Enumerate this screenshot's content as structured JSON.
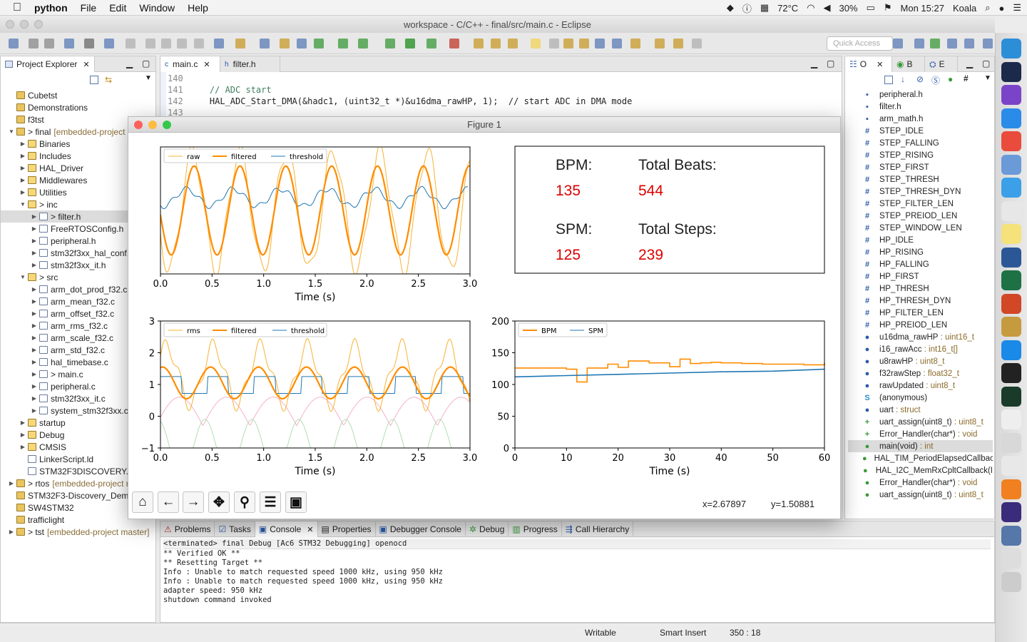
{
  "menubar": {
    "apple": "",
    "app": "python",
    "items": [
      "File",
      "Edit",
      "Window",
      "Help"
    ],
    "status": {
      "temp": "72°C",
      "battery": "30%",
      "clock": "Mon 15:27",
      "user": "Koala"
    }
  },
  "window": {
    "title": "workspace - C/C++ - final/src/main.c - Eclipse",
    "quick_access": "Quick Access"
  },
  "project_explorer": {
    "title": "Project Explorer",
    "rows": [
      {
        "label": "Cubetst",
        "kind": "proj",
        "depth": 0,
        "tw": ""
      },
      {
        "label": "Demonstrations",
        "kind": "proj",
        "depth": 0,
        "tw": ""
      },
      {
        "label": "f3tst",
        "kind": "proj",
        "depth": 0,
        "tw": ""
      },
      {
        "label": "> final",
        "extra": "[embedded-project",
        "kind": "proj",
        "depth": 0,
        "tw": "▼"
      },
      {
        "label": "Binaries",
        "kind": "folder",
        "depth": 1,
        "tw": "▶"
      },
      {
        "label": "Includes",
        "kind": "folder",
        "depth": 1,
        "tw": "▶"
      },
      {
        "label": "HAL_Driver",
        "kind": "folder",
        "depth": 1,
        "tw": "▶"
      },
      {
        "label": "Middlewares",
        "kind": "folder",
        "depth": 1,
        "tw": "▶"
      },
      {
        "label": "Utilities",
        "kind": "folder",
        "depth": 1,
        "tw": "▶"
      },
      {
        "label": "> inc",
        "kind": "folder",
        "depth": 1,
        "tw": "▼"
      },
      {
        "label": "> filter.h",
        "kind": "file",
        "depth": 2,
        "tw": "▶",
        "selected": true
      },
      {
        "label": "FreeRTOSConfig.h",
        "kind": "file",
        "depth": 2,
        "tw": "▶"
      },
      {
        "label": "peripheral.h",
        "kind": "file",
        "depth": 2,
        "tw": "▶"
      },
      {
        "label": "stm32f3xx_hal_conf.",
        "kind": "file",
        "depth": 2,
        "tw": "▶"
      },
      {
        "label": "stm32f3xx_it.h",
        "kind": "file",
        "depth": 2,
        "tw": "▶"
      },
      {
        "label": "> src",
        "kind": "folder",
        "depth": 1,
        "tw": "▼"
      },
      {
        "label": "arm_dot_prod_f32.c",
        "kind": "file",
        "depth": 2,
        "tw": "▶"
      },
      {
        "label": "arm_mean_f32.c",
        "kind": "file",
        "depth": 2,
        "tw": "▶"
      },
      {
        "label": "arm_offset_f32.c",
        "kind": "file",
        "depth": 2,
        "tw": "▶"
      },
      {
        "label": "arm_rms_f32.c",
        "kind": "file",
        "depth": 2,
        "tw": "▶"
      },
      {
        "label": "arm_scale_f32.c",
        "kind": "file",
        "depth": 2,
        "tw": "▶"
      },
      {
        "label": "arm_std_f32.c",
        "kind": "file",
        "depth": 2,
        "tw": "▶"
      },
      {
        "label": "hal_timebase.c",
        "kind": "file",
        "depth": 2,
        "tw": "▶"
      },
      {
        "label": "> main.c",
        "kind": "file",
        "depth": 2,
        "tw": "▶"
      },
      {
        "label": "peripheral.c",
        "kind": "file",
        "depth": 2,
        "tw": "▶"
      },
      {
        "label": "stm32f3xx_it.c",
        "kind": "file",
        "depth": 2,
        "tw": "▶"
      },
      {
        "label": "system_stm32f3xx.c",
        "kind": "file",
        "depth": 2,
        "tw": "▶"
      },
      {
        "label": "startup",
        "kind": "folder",
        "depth": 1,
        "tw": "▶"
      },
      {
        "label": "Debug",
        "kind": "folder",
        "depth": 1,
        "tw": "▶"
      },
      {
        "label": "CMSIS",
        "kind": "folder",
        "depth": 1,
        "tw": "▶"
      },
      {
        "label": "LinkerScript.ld",
        "kind": "file",
        "depth": 1,
        "tw": ""
      },
      {
        "label": "STM32F3DISCOVERY.x",
        "kind": "file",
        "depth": 1,
        "tw": ""
      },
      {
        "label": "> rtos",
        "extra": "[embedded-project r",
        "kind": "proj",
        "depth": 0,
        "tw": "▶"
      },
      {
        "label": "STM32F3-Discovery_Demo",
        "kind": "proj",
        "depth": 0,
        "tw": ""
      },
      {
        "label": "SW4STM32",
        "kind": "proj",
        "depth": 0,
        "tw": ""
      },
      {
        "label": "trafficlight",
        "kind": "proj",
        "depth": 0,
        "tw": ""
      },
      {
        "label": "> tst",
        "extra": "[embedded-project master]",
        "kind": "proj",
        "depth": 0,
        "tw": "▶"
      }
    ]
  },
  "editor": {
    "tabs": [
      {
        "label": "main.c",
        "active": true
      },
      {
        "label": "filter.h",
        "active": false
      }
    ],
    "lines": [
      {
        "num": "140",
        "text": ""
      },
      {
        "num": "141",
        "text": "    // ADC start"
      },
      {
        "num": "142",
        "text": "    HAL_ADC_Start_DMA(&hadc1, (uint32_t *)&u16dma_rawHP, 1);  // start ADC in DMA mode"
      },
      {
        "num": "143",
        "text": ""
      }
    ]
  },
  "outline": {
    "tabs": [
      "O",
      "B",
      "E"
    ],
    "rows": [
      {
        "icon": "▪",
        "color": "#2b5aa8",
        "name": "peripheral.h",
        "type": ""
      },
      {
        "icon": "▪",
        "color": "#2b5aa8",
        "name": "filter.h",
        "type": ""
      },
      {
        "icon": "▪",
        "color": "#2b5aa8",
        "name": "arm_math.h",
        "type": ""
      },
      {
        "icon": "#",
        "color": "#2b5aa8",
        "name": "STEP_IDLE",
        "type": ""
      },
      {
        "icon": "#",
        "color": "#2b5aa8",
        "name": "STEP_FALLING",
        "type": ""
      },
      {
        "icon": "#",
        "color": "#2b5aa8",
        "name": "STEP_RISING",
        "type": ""
      },
      {
        "icon": "#",
        "color": "#2b5aa8",
        "name": "STEP_FIRST",
        "type": ""
      },
      {
        "icon": "#",
        "color": "#2b5aa8",
        "name": "STEP_THRESH",
        "type": ""
      },
      {
        "icon": "#",
        "color": "#2b5aa8",
        "name": "STEP_THRESH_DYN",
        "type": ""
      },
      {
        "icon": "#",
        "color": "#2b5aa8",
        "name": "STEP_FILTER_LEN",
        "type": ""
      },
      {
        "icon": "#",
        "color": "#2b5aa8",
        "name": "STEP_PREIOD_LEN",
        "type": ""
      },
      {
        "icon": "#",
        "color": "#2b5aa8",
        "name": "STEP_WINDOW_LEN",
        "type": ""
      },
      {
        "icon": "#",
        "color": "#2b5aa8",
        "name": "HP_IDLE",
        "type": ""
      },
      {
        "icon": "#",
        "color": "#2b5aa8",
        "name": "HP_RISING",
        "type": ""
      },
      {
        "icon": "#",
        "color": "#2b5aa8",
        "name": "HP_FALLING",
        "type": ""
      },
      {
        "icon": "#",
        "color": "#2b5aa8",
        "name": "HP_FIRST",
        "type": ""
      },
      {
        "icon": "#",
        "color": "#2b5aa8",
        "name": "HP_THRESH",
        "type": ""
      },
      {
        "icon": "#",
        "color": "#2b5aa8",
        "name": "HP_THRESH_DYN",
        "type": ""
      },
      {
        "icon": "#",
        "color": "#2b5aa8",
        "name": "HP_FILTER_LEN",
        "type": ""
      },
      {
        "icon": "#",
        "color": "#2b5aa8",
        "name": "HP_PREIOD_LEN",
        "type": ""
      },
      {
        "icon": "●",
        "color": "#2b5aa8",
        "name": "u16dma_rawHP",
        "type": " : uint16_t"
      },
      {
        "icon": "●",
        "color": "#2b5aa8",
        "name": "i16_rawAcc",
        "type": " : int16_t[]"
      },
      {
        "icon": "●",
        "color": "#2b5aa8",
        "name": "u8rawHP",
        "type": " : uint8_t"
      },
      {
        "icon": "●",
        "color": "#2b5aa8",
        "name": "f32rawStep",
        "type": " : float32_t"
      },
      {
        "icon": "●",
        "color": "#2b5aa8",
        "name": "rawUpdated",
        "type": " : uint8_t"
      },
      {
        "icon": "S",
        "color": "#2b8fc9",
        "name": "(anonymous)",
        "type": ""
      },
      {
        "icon": "●",
        "color": "#2b5aa8",
        "name": "uart",
        "type": " : struct"
      },
      {
        "icon": "+",
        "color": "#3a9a3a",
        "name": "uart_assign(uint8_t)",
        "type": " : uint8_t"
      },
      {
        "icon": "+",
        "color": "#3a9a3a",
        "name": "Error_Handler(char*)",
        "type": " : void"
      },
      {
        "icon": "●",
        "color": "#3a9a3a",
        "name": "main(void)",
        "type": " : int",
        "selected": true
      },
      {
        "icon": "●",
        "color": "#3a9a3a",
        "name": "HAL_TIM_PeriodElapsedCallbac",
        "type": ""
      },
      {
        "icon": "●",
        "color": "#3a9a3a",
        "name": "HAL_I2C_MemRxCpltCallback(I",
        "type": ""
      },
      {
        "icon": "●",
        "color": "#3a9a3a",
        "name": "Error_Handler(char*)",
        "type": " : void"
      },
      {
        "icon": "●",
        "color": "#3a9a3a",
        "name": "uart_assign(uint8_t)",
        "type": " : uint8_t"
      }
    ]
  },
  "bottom": {
    "tabs": [
      "Problems",
      "Tasks",
      "Console",
      "Properties",
      "Debugger Console",
      "Debug",
      "Progress",
      "Call Hierarchy"
    ],
    "console_header": "<terminated> final Debug [Ac6 STM32 Debugging] openocd",
    "console_lines": [
      "** Verified OK **",
      "** Resetting Target **",
      "Info : Unable to match requested speed 1000 kHz, using 950 kHz",
      "Info : Unable to match requested speed 1000 kHz, using 950 kHz",
      "adapter speed: 950 kHz",
      "shutdown command invoked"
    ]
  },
  "status": {
    "writable": "Writable",
    "insert": "Smart Insert",
    "position": "350 : 18"
  },
  "figure": {
    "title": "Figure 1",
    "stats": {
      "bpm_label": "BPM:",
      "bpm_value": "135",
      "beats_label": "Total Beats:",
      "beats_value": "544",
      "spm_label": "SPM:",
      "spm_value": "125",
      "steps_label": "Total Steps:",
      "steps_value": "239"
    },
    "coords": {
      "x": "x=2.67897",
      "y": "y=1.50881"
    },
    "toolbar": [
      "home",
      "back",
      "forward",
      "pan",
      "zoom",
      "configure",
      "save"
    ]
  },
  "colors": {
    "orange": "#ff8c00",
    "blue": "#1f77b4",
    "red": "#dd0000",
    "rms": "#f2a0bd",
    "rms2": "#9fd89f"
  },
  "chart_data": [
    {
      "type": "line",
      "xlabel": "Time (s)",
      "xlim": [
        0,
        3.0
      ],
      "xticks": [
        "0.0",
        "0.5",
        "1.0",
        "1.5",
        "2.0",
        "2.5",
        "3.0"
      ],
      "legend": "top-left",
      "series": [
        {
          "name": "raw",
          "color": "#f9b233",
          "freq": 2.2,
          "amp": 0.9,
          "phase": 0.4
        },
        {
          "name": "filtered",
          "color": "#ff8c00",
          "freq": 2.25,
          "amp": 0.75,
          "phase": 0.1
        },
        {
          "name": "threshold",
          "color": "#1f77b4",
          "freq": 0,
          "amp": 0.15,
          "phase": 0
        }
      ]
    },
    {
      "type": "line",
      "xlabel": "Time (s)",
      "xlim": [
        0,
        3.0
      ],
      "ylim": [
        -1,
        3
      ],
      "xticks": [
        "0.0",
        "0.5",
        "1.0",
        "1.5",
        "2.0",
        "2.5",
        "3.0"
      ],
      "yticks": [
        "3",
        "2",
        "1",
        "0",
        "−1"
      ],
      "legend": "top-left",
      "series": [
        {
          "name": "rms",
          "color": "#f9b233"
        },
        {
          "name": "filtered",
          "color": "#ff8c00"
        },
        {
          "name": "threshold",
          "color": "#1f77b4"
        }
      ]
    },
    {
      "type": "line",
      "xlabel": "Time (s)",
      "xlim": [
        0,
        60
      ],
      "ylim": [
        0,
        200
      ],
      "xticks": [
        "0",
        "10",
        "20",
        "30",
        "40",
        "50",
        "60"
      ],
      "yticks": [
        "200",
        "150",
        "100",
        "50",
        "0"
      ],
      "legend": "top-left",
      "series": [
        {
          "name": "BPM",
          "color": "#ff8c00",
          "x": [
            0,
            10,
            12,
            14,
            18,
            20,
            22,
            26,
            28,
            30,
            32,
            34,
            36,
            38,
            40,
            44,
            48,
            52,
            56,
            60
          ],
          "values": [
            126,
            124,
            104,
            126,
            132,
            127,
            137,
            134,
            134,
            128,
            140,
            133,
            134,
            135,
            134,
            133,
            132,
            132,
            131,
            134
          ]
        },
        {
          "name": "SPM",
          "color": "#1f77b4",
          "x": [
            0,
            10,
            20,
            30,
            40,
            50,
            60
          ],
          "values": [
            112,
            114,
            116,
            118,
            120,
            121,
            124
          ]
        }
      ]
    }
  ]
}
